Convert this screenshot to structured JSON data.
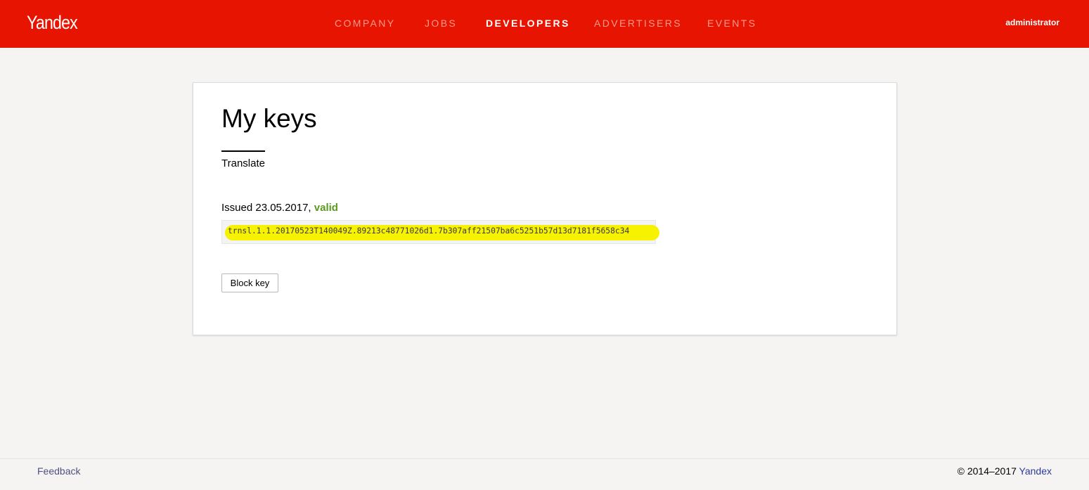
{
  "header": {
    "logo": "Yandex",
    "nav": [
      "COMPANY",
      "JOBS",
      "DEVELOPERS",
      "ADVERTISERS",
      "EVENTS"
    ],
    "active_nav": "DEVELOPERS",
    "user": "administrator"
  },
  "main": {
    "title": "My keys",
    "tab_label": "Translate",
    "issued_text": "Issued 23.05.2017, ",
    "status": "valid",
    "api_key": "trnsl.1.1.20170523T140049Z.89213c48771026d1.7b307aff21507ba6c5251b57d13d7181f5658c34",
    "block_button": "Block key"
  },
  "footer": {
    "feedback": "Feedback",
    "copyright": "© 2014–2017",
    "copyright_link": "Yandex"
  },
  "colors": {
    "brand": "#e61400",
    "status_valid": "#5a9a1e",
    "key_highlight": "#f7f200"
  }
}
